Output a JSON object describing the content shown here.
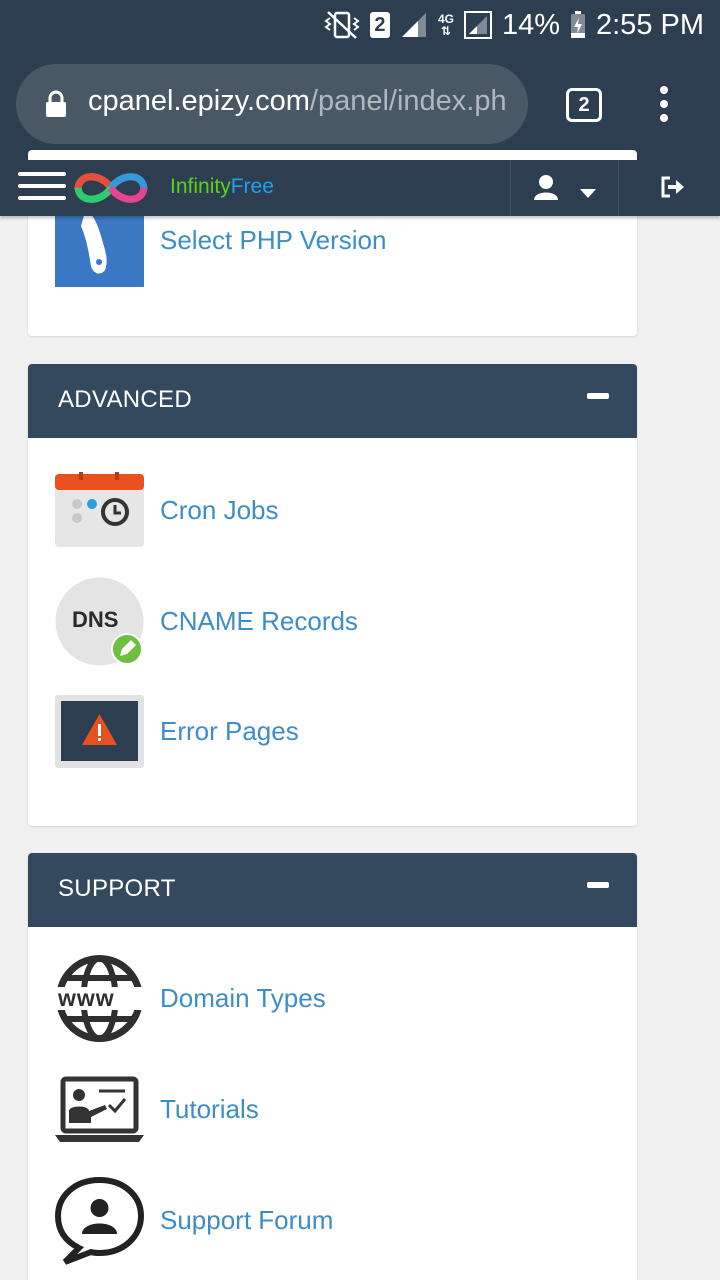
{
  "status_bar": {
    "sim_slot": "2",
    "network": "4G",
    "battery": "14%",
    "time": "2:55 PM"
  },
  "browser": {
    "url_host": "cpanel.epizy.com",
    "url_path": "/panel/index.ph",
    "tab_count": "2"
  },
  "navbar": {
    "brand_part1": "Infinity",
    "brand_part2": "Free"
  },
  "sections": {
    "top": {
      "items": [
        {
          "label": "Select PHP Version",
          "icon": "php-version-icon"
        }
      ]
    },
    "advanced": {
      "title": "ADVANCED",
      "items": [
        {
          "label": "Cron Jobs",
          "icon": "cron-jobs-icon"
        },
        {
          "label": "CNAME Records",
          "icon": "dns-icon",
          "icon_text": "DNS"
        },
        {
          "label": "Error Pages",
          "icon": "error-pages-icon"
        }
      ]
    },
    "support": {
      "title": "SUPPORT",
      "items": [
        {
          "label": "Domain Types",
          "icon": "www-globe-icon",
          "icon_text": "www"
        },
        {
          "label": "Tutorials",
          "icon": "tutorials-icon"
        },
        {
          "label": "Support Forum",
          "icon": "support-forum-icon"
        }
      ]
    }
  },
  "colors": {
    "header_bg": "#2c3e50",
    "panel_head_bg": "#34495e",
    "link": "#3d8dc7",
    "brand_green": "#58d11f",
    "brand_blue": "#1ea1f2"
  }
}
